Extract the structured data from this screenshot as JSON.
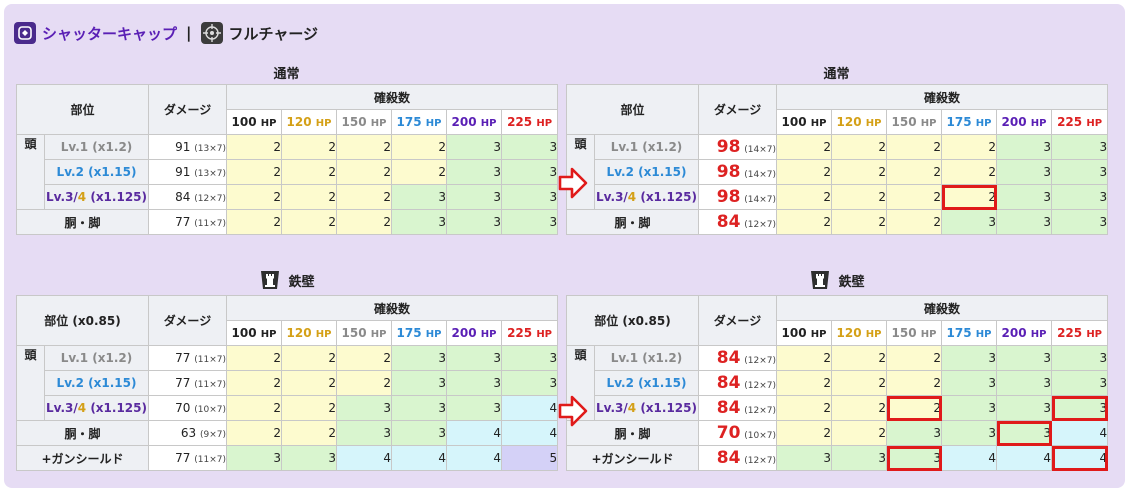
{
  "header": {
    "weapon_icon": "shatter-cap-icon",
    "weapon_name": "シャッターキャップ",
    "separator": "|",
    "feature_icon": "crosshair-icon",
    "feature_name": "フルチャージ"
  },
  "captions": {
    "normal": "通常",
    "tekkeki": "鉄壁",
    "tekkeki_icon": "rook-icon"
  },
  "columns": {
    "part": "部位",
    "part_tekkeki": "部位 (x0.85)",
    "damage": "ダメージ",
    "kill_count": "確殺数",
    "hp": [
      "100",
      "120",
      "150",
      "175",
      "200",
      "225"
    ],
    "hp_unit": "HP",
    "hp_colors": [
      "#222222",
      "#d4a017",
      "#8a8a8a",
      "#2d8ad6",
      "#5a1fb5",
      "#dd2222"
    ]
  },
  "labels": {
    "head": "頭",
    "lv1": "Lv.1 (x1.2)",
    "lv2": "Lv.2 (x1.15)",
    "lv3_a": "Lv.3/",
    "lv3_b": "4",
    "lv3_c": " (x1.125)",
    "body": "胴・脚",
    "gun_shield": "+ガンシールド"
  },
  "tables": {
    "normal_before": {
      "rows": [
        {
          "dmg": "91",
          "detail": "(13×7)",
          "vals": [
            "2",
            "2",
            "2",
            "2",
            "3",
            "3"
          ]
        },
        {
          "dmg": "91",
          "detail": "(13×7)",
          "vals": [
            "2",
            "2",
            "2",
            "2",
            "3",
            "3"
          ]
        },
        {
          "dmg": "84",
          "detail": "(12×7)",
          "vals": [
            "2",
            "2",
            "2",
            "3",
            "3",
            "3"
          ]
        },
        {
          "dmg": "77",
          "detail": "(11×7)",
          "vals": [
            "2",
            "2",
            "2",
            "3",
            "3",
            "3"
          ]
        }
      ]
    },
    "normal_after": {
      "rows": [
        {
          "dmg": "98",
          "detail": "(14×7)",
          "vals": [
            "2",
            "2",
            "2",
            "2",
            "3",
            "3"
          ]
        },
        {
          "dmg": "98",
          "detail": "(14×7)",
          "vals": [
            "2",
            "2",
            "2",
            "2",
            "3",
            "3"
          ]
        },
        {
          "dmg": "98",
          "detail": "(14×7)",
          "vals": [
            "2",
            "2",
            "2",
            "2",
            "3",
            "3"
          ]
        },
        {
          "dmg": "84",
          "detail": "(12×7)",
          "vals": [
            "2",
            "2",
            "2",
            "3",
            "3",
            "3"
          ]
        }
      ]
    },
    "tekkeki_before": {
      "rows": [
        {
          "dmg": "77",
          "detail": "(11×7)",
          "vals": [
            "2",
            "2",
            "2",
            "3",
            "3",
            "3"
          ]
        },
        {
          "dmg": "77",
          "detail": "(11×7)",
          "vals": [
            "2",
            "2",
            "2",
            "3",
            "3",
            "3"
          ]
        },
        {
          "dmg": "70",
          "detail": "(10×7)",
          "vals": [
            "2",
            "2",
            "3",
            "3",
            "3",
            "4"
          ]
        },
        {
          "dmg": "63",
          "detail": "(9×7)",
          "vals": [
            "2",
            "2",
            "3",
            "3",
            "4",
            "4"
          ]
        },
        {
          "dmg": "77",
          "detail": "(11×7)",
          "vals": [
            "3",
            "3",
            "4",
            "4",
            "4",
            "5"
          ]
        }
      ]
    },
    "tekkeki_after": {
      "rows": [
        {
          "dmg": "84",
          "detail": "(12×7)",
          "vals": [
            "2",
            "2",
            "2",
            "3",
            "3",
            "3"
          ]
        },
        {
          "dmg": "84",
          "detail": "(12×7)",
          "vals": [
            "2",
            "2",
            "2",
            "3",
            "3",
            "3"
          ]
        },
        {
          "dmg": "84",
          "detail": "(12×7)",
          "vals": [
            "2",
            "2",
            "2",
            "3",
            "3",
            "3"
          ]
        },
        {
          "dmg": "70",
          "detail": "(10×7)",
          "vals": [
            "2",
            "2",
            "3",
            "3",
            "3",
            "4"
          ]
        },
        {
          "dmg": "84",
          "detail": "(12×7)",
          "vals": [
            "3",
            "3",
            "3",
            "4",
            "4",
            "4"
          ]
        }
      ]
    }
  },
  "highlight_color": "#e01a1a",
  "arrow_icon": "right-arrow-icon"
}
